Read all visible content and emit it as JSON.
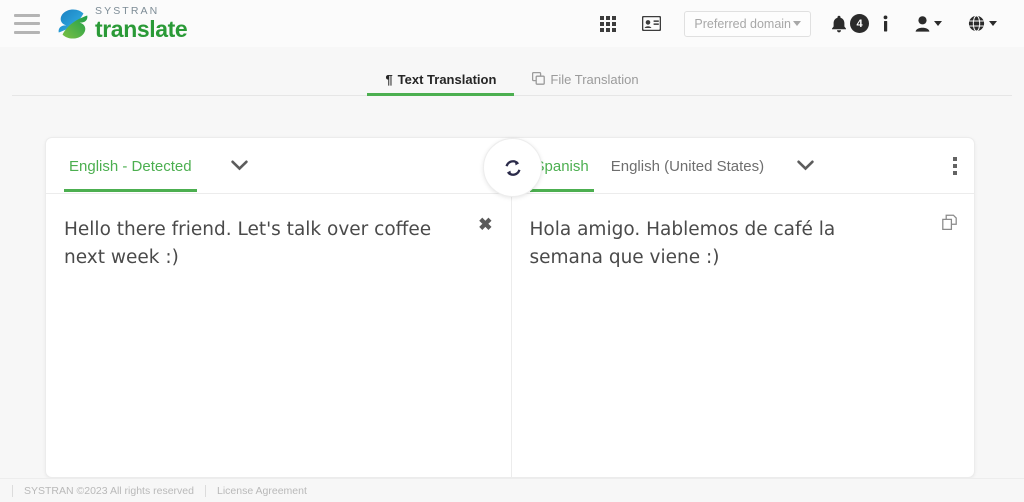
{
  "header": {
    "menu_icon": "hamburger-icon",
    "brand_top": "SYSTRAN",
    "brand_bottom": "translate",
    "apps_icon": "grid-apps-icon",
    "card_icon": "id-card-icon",
    "domain_select": {
      "label": "Preferred domain",
      "caret": "caret-down-icon"
    },
    "bell_icon": "bell-icon",
    "notification_count": "4",
    "info_icon": "info-icon",
    "user_icon": "user-icon",
    "globe_icon": "globe-icon"
  },
  "tabs": [
    {
      "label": "Text Translation",
      "icon": "pilcrow-icon",
      "icon_glyph": "¶",
      "active": true
    },
    {
      "label": "File Translation",
      "icon": "file-copy-icon",
      "icon_glyph": "❐",
      "active": false
    }
  ],
  "translator": {
    "source": {
      "language_label": "English - Detected",
      "chevron_icon": "chevron-down-icon",
      "text": "Hello there friend. Let's talk over coffee next week :)",
      "clear_icon": "close-x-icon",
      "clear_glyph": "✖"
    },
    "swap": {
      "icon": "swap-languages-icon"
    },
    "target": {
      "language_primary": "Spanish",
      "language_secondary": "English (United States)",
      "chevron_icon": "chevron-down-icon",
      "kebab_icon": "more-options-icon",
      "text": "Hola amigo. Hablemos de café la semana que viene :)",
      "copy_icon": "copy-icon"
    }
  },
  "footer": {
    "copyright": "SYSTRAN ©2023 All rights reserved",
    "license_link": "License Agreement"
  },
  "colors": {
    "accent_green": "#4caf50",
    "brand_green": "#2a9a37",
    "page_bg": "#f7f7f7",
    "text_dark": "#4a4a4a",
    "muted": "#9b9b9b"
  }
}
